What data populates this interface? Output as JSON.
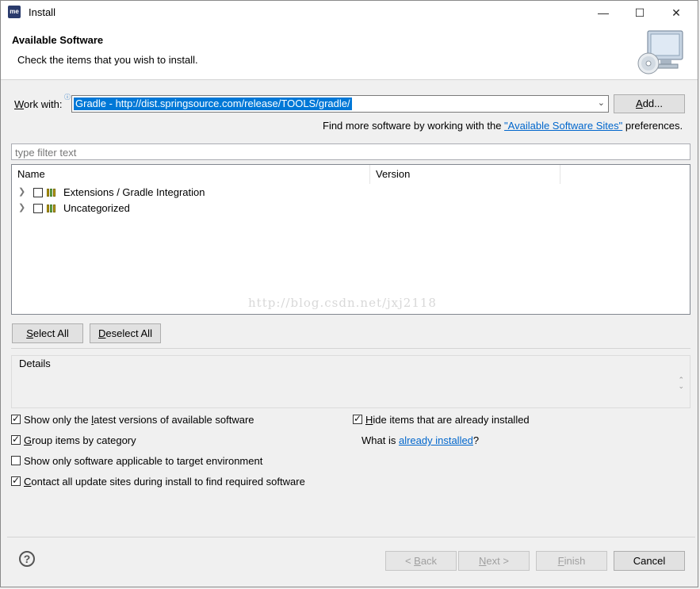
{
  "window": {
    "app_icon_text": "me",
    "title": "Install",
    "controls": {
      "minimize": "—",
      "maximize": "☐",
      "close": "✕"
    }
  },
  "header": {
    "title": "Available Software",
    "subtitle": "Check the items that you wish to install."
  },
  "work_with": {
    "label_key": "W",
    "label_rest": "ork with:",
    "value": "Gradle - http://dist.springsource.com/release/TOOLS/gradle/",
    "add_button_key": "A",
    "add_button_rest": "dd..."
  },
  "more_software": {
    "prefix": "Find more software by working with the ",
    "link": "\"Available Software Sites\"",
    "suffix": " preferences."
  },
  "filter": {
    "placeholder": "type filter text"
  },
  "tree": {
    "columns": [
      "Name",
      "Version"
    ],
    "rows": [
      {
        "label": "Extensions / Gradle Integration",
        "checked": false
      },
      {
        "label": "Uncategorized",
        "checked": false
      }
    ]
  },
  "watermark": "http://blog.csdn.net/jxj2118",
  "selection_buttons": {
    "select_all_key": "S",
    "select_all_rest": "elect All",
    "deselect_all_key": "D",
    "deselect_all_rest": "eselect All"
  },
  "details": {
    "label": "Details"
  },
  "options": {
    "show_latest": {
      "pre": "Show only the ",
      "key": "l",
      "post": "atest versions of available software",
      "checked": true
    },
    "group_by_category": {
      "pre": "",
      "key": "G",
      "post": "roup items by category",
      "checked": true
    },
    "show_applicable": {
      "pre": "Show only software applicable to target environment",
      "key": "",
      "post": "",
      "checked": false
    },
    "contact_sites": {
      "pre": "",
      "key": "C",
      "post": "ontact all update sites during install to find required software",
      "checked": true
    },
    "hide_installed": {
      "pre": "",
      "key": "H",
      "post": "ide items that are already installed",
      "checked": true
    },
    "what_is": {
      "prefix": "What is ",
      "link": "already installed",
      "suffix": "?"
    }
  },
  "footer": {
    "help_icon": "?",
    "back_pre": "< ",
    "back_key": "B",
    "back_rest": "ack",
    "next_key": "N",
    "next_rest": "ext >",
    "finish_key": "F",
    "finish_rest": "inish",
    "cancel": "Cancel"
  }
}
